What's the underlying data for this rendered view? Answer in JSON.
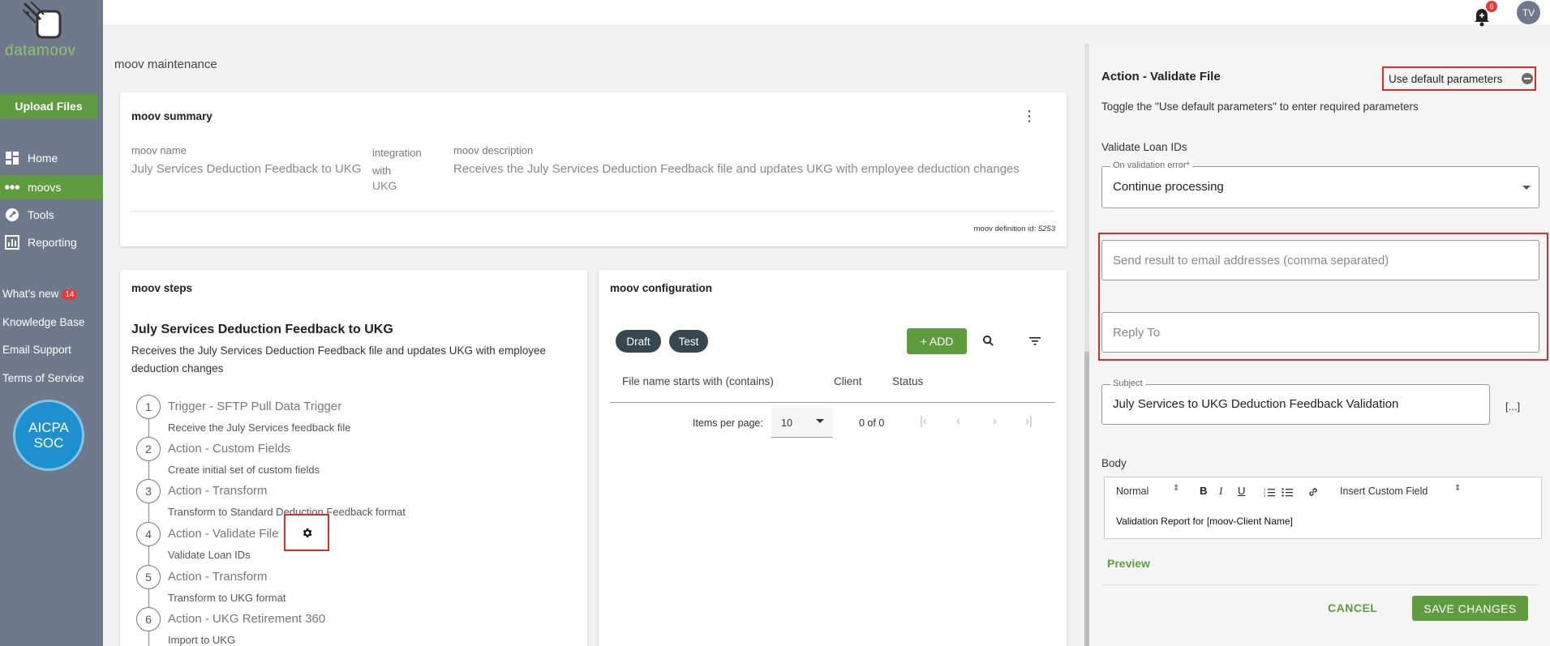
{
  "sidebar": {
    "logo_text": "datamoov",
    "upload_label": "Upload Files",
    "nav": [
      {
        "label": "Home",
        "icon": "dashboard-icon"
      },
      {
        "label": "moovs",
        "icon": "moovs-icon"
      },
      {
        "label": "Tools",
        "icon": "wrench-icon"
      },
      {
        "label": "Reporting",
        "icon": "chart-icon"
      }
    ],
    "links": {
      "whats_new": "What's new",
      "whats_new_count": "14",
      "kb": "Knowledge Base",
      "email": "Email Support",
      "terms": "Terms of Service"
    },
    "aicpa": {
      "line1": "AICPA",
      "line2": "SOC"
    }
  },
  "topbar": {
    "notifications": "6",
    "avatar": "TV"
  },
  "page": {
    "title": "moov maintenance"
  },
  "summary": {
    "title": "moov summary",
    "name_label": "moov name",
    "name_value": "July Services Deduction Feedback to UKG",
    "integration_label": "integration with",
    "integration_value": "UKG",
    "desc_label": "moov description",
    "desc_value": "Receives the July Services Deduction Feedback file and updates UKG with employee deduction changes",
    "def_label": "moov definition id:",
    "def_id": "5253"
  },
  "steps": {
    "title": "moov steps",
    "moov_name": "July Services Deduction Feedback to UKG",
    "moov_desc": "Receives the July Services Deduction Feedback file and updates UKG with employee deduction changes",
    "items": [
      {
        "num": "1",
        "title": "Trigger - SFTP Pull Data Trigger",
        "sub": "Receive the July Services feedback file"
      },
      {
        "num": "2",
        "title": "Action - Custom Fields",
        "sub": "Create initial set of custom fields"
      },
      {
        "num": "3",
        "title": "Action - Transform",
        "sub": "Transform to Standard Deduction Feedback format"
      },
      {
        "num": "4",
        "title": "Action - Validate File",
        "sub": "Validate Loan IDs"
      },
      {
        "num": "5",
        "title": "Action - Transform",
        "sub": "Transform to UKG format"
      },
      {
        "num": "6",
        "title": "Action - UKG Retirement 360",
        "sub": "Import to UKG"
      }
    ]
  },
  "config": {
    "title": "moov configuration",
    "chips": [
      "Draft",
      "Test"
    ],
    "add_label": "+ ADD",
    "columns": [
      "File name starts with (contains)",
      "Client",
      "Status"
    ],
    "items_per_page_label": "Items per page:",
    "items_per_page": "10",
    "range": "0 of 0"
  },
  "panel": {
    "title": "Action - Validate File",
    "default_params_label": "Use default parameters",
    "hint": "Toggle the \"Use default parameters\" to enter required parameters",
    "section": "Validate Loan IDs",
    "on_error_label": "On validation error*",
    "on_error_value": "Continue processing",
    "email_placeholder": "Send result to email addresses (comma separated)",
    "reply_placeholder": "Reply To",
    "subject_label": "Subject",
    "subject_value": "July Services to UKG Deduction Feedback Validation",
    "ellipsis": "[...]",
    "body_label": "Body",
    "toolbar": {
      "format": "Normal",
      "bold": "B",
      "italic": "I",
      "underline": "U",
      "custom_field": "Insert Custom Field"
    },
    "body_text": "Validation Report for [moov-Client Name]",
    "preview": "Preview",
    "cancel": "CANCEL",
    "save": "SAVE CHANGES"
  }
}
